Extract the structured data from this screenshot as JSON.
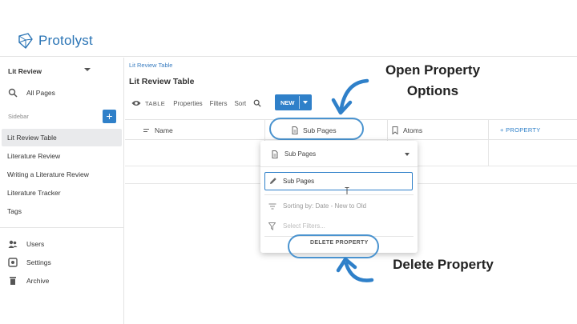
{
  "app": {
    "name": "Protolyst",
    "accent": "#2f80c9"
  },
  "sidebar": {
    "workspace": "Lit Review",
    "all_pages": "All Pages",
    "section_label": "Sidebar",
    "add_label": "+",
    "pages": [
      {
        "label": "Lit Review Table",
        "active": true
      },
      {
        "label": "Literature Review",
        "active": false
      },
      {
        "label": "Writing a Literature Review",
        "active": false
      },
      {
        "label": "Literature Tracker",
        "active": false
      },
      {
        "label": "Tags",
        "active": false
      }
    ],
    "bottom": [
      {
        "label": "Users",
        "icon": "users-icon"
      },
      {
        "label": "Settings",
        "icon": "settings-icon"
      },
      {
        "label": "Archive",
        "icon": "archive-icon"
      }
    ]
  },
  "main": {
    "breadcrumb": "Lit Review Table",
    "title": "Lit Review Table",
    "toolbar": {
      "view": "TABLE",
      "properties": "Properties",
      "filters": "Filters",
      "sort": "Sort",
      "new": "NEW"
    },
    "columns": {
      "name": "Name",
      "sub_pages": "Sub Pages",
      "atoms": "Atoms",
      "add_property": "+ PROPERTY"
    }
  },
  "popup": {
    "header": "Sub Pages",
    "input_value": "Sub Pages",
    "sorting": "Sorting by: Date - New to Old",
    "filters_placeholder": "Select Filters...",
    "delete": "DELETE PROPERTY"
  },
  "annotations": {
    "open_options_line1": "Open Property",
    "open_options_line2": "Options",
    "delete_property": "Delete Property"
  }
}
